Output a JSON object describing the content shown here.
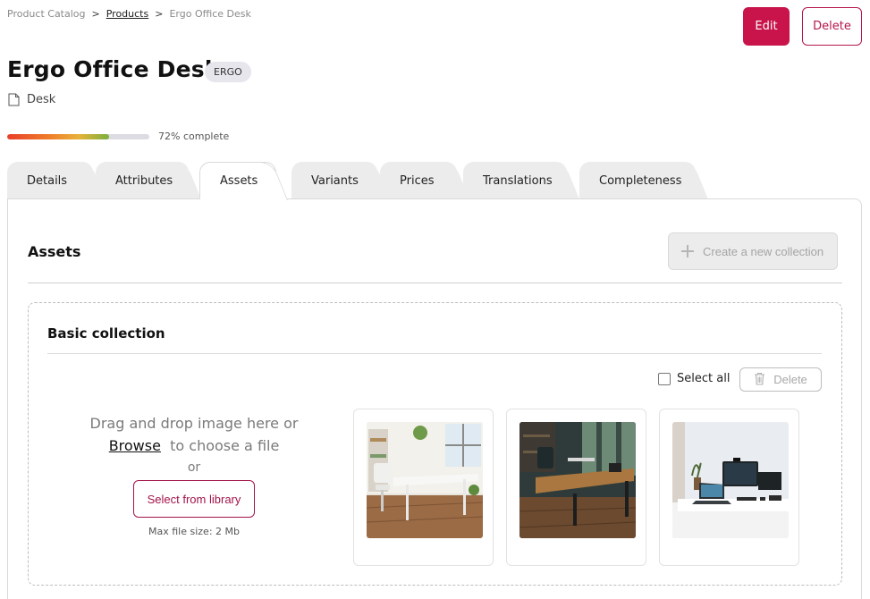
{
  "breadcrumb": {
    "root": "Product Catalog",
    "separator": ">",
    "products": "Products",
    "current": "Ergo Office Desk"
  },
  "actions": {
    "edit": "Edit",
    "delete": "Delete"
  },
  "product": {
    "title": "Ergo Office Desk",
    "code": "ERGO",
    "family": "Desk",
    "completeness_percent": 72,
    "completeness_label": "72% complete"
  },
  "tabs": [
    {
      "label": "Details"
    },
    {
      "label": "Attributes"
    },
    {
      "label": "Assets",
      "active": true
    },
    {
      "label": "Variants"
    },
    {
      "label": "Prices"
    },
    {
      "label": "Translations"
    },
    {
      "label": "Completeness"
    }
  ],
  "assets": {
    "title": "Assets",
    "new_collection": "Create a new collection",
    "collection": {
      "title": "Basic collection",
      "select_all": "Select all",
      "delete": "Delete",
      "drop_text": "Drag and drop image here or",
      "browse": "Browse",
      "browse_suffix": "to choose a file",
      "or": "or",
      "select_library": "Select from library",
      "max_size": "Max file size: 2 Mb"
    }
  },
  "colors": {
    "primary": "#c8144a",
    "progress_start": "#e8402a",
    "progress_end": "#7bb03c"
  }
}
